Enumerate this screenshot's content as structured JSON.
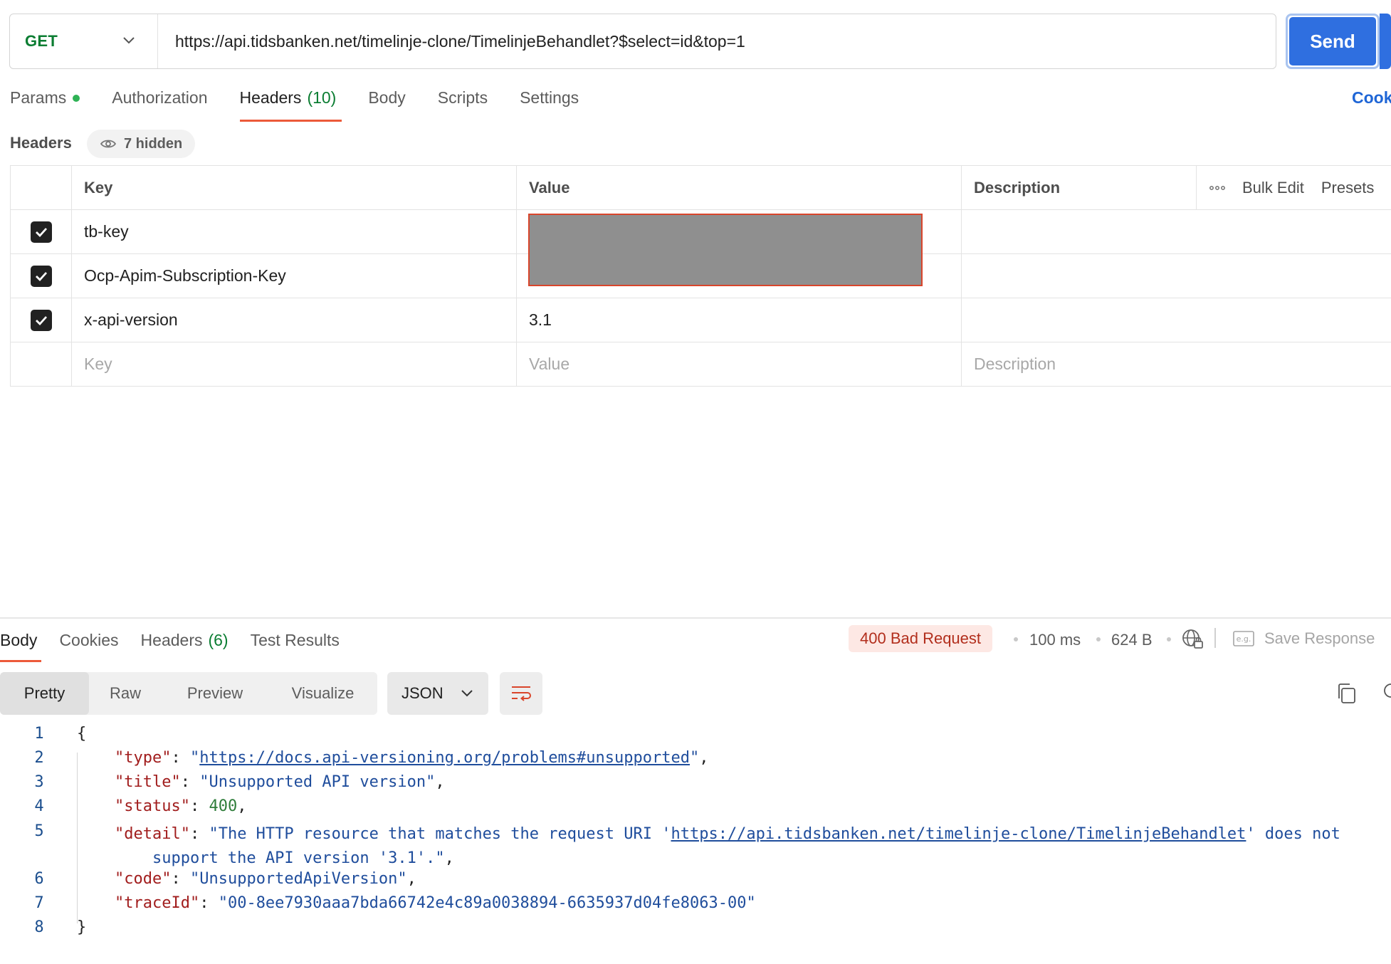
{
  "request": {
    "method": "GET",
    "url": "https://api.tidsbanken.net/timelinje-clone/TimelinjeBehandlet?$select=id&top=1",
    "send_label": "Send"
  },
  "request_tabs": {
    "params": "Params",
    "authorization": "Authorization",
    "headers": "Headers",
    "headers_count": "(10)",
    "body": "Body",
    "scripts": "Scripts",
    "settings": "Settings",
    "cookies_link": "Cook"
  },
  "headers_section": {
    "label": "Headers",
    "hidden_label": "7 hidden",
    "columns": {
      "key": "Key",
      "value": "Value",
      "description": "Description"
    },
    "bulk_edit": "Bulk Edit",
    "presets": "Presets",
    "rows": [
      {
        "key": "tb-key",
        "value": "",
        "enabled": true
      },
      {
        "key": "Ocp-Apim-Subscription-Key",
        "value": "",
        "enabled": true
      },
      {
        "key": "x-api-version",
        "value": "3.1",
        "enabled": true
      }
    ],
    "placeholders": {
      "key": "Key",
      "value": "Value",
      "description": "Description"
    }
  },
  "response": {
    "tabs": {
      "body": "Body",
      "cookies": "Cookies",
      "headers": "Headers",
      "headers_count": "(6)",
      "test_results": "Test Results"
    },
    "status": "400 Bad Request",
    "time": "100 ms",
    "size": "624 B",
    "save_label": "Save Response",
    "view_modes": [
      "Pretty",
      "Raw",
      "Preview",
      "Visualize"
    ],
    "format": "JSON",
    "json": {
      "type_url": "https://docs.api-versioning.org/problems#unsupported",
      "title": "Unsupported API version",
      "status": "400",
      "detail_prefix": "The HTTP resource that matches the request URI '",
      "detail_url": "https://api.tidsbanken.net/timelinje-clone/TimelinjeBehandlet",
      "detail_suffix": "' does not",
      "detail_cont": "support the API version '3.1'.",
      "code": "UnsupportedApiVersion",
      "traceId": "00-8ee7930aaa7bda66742e4c89a0038894-6635937d04fe8063-00"
    }
  },
  "colors": {
    "send": "#2f6fe0",
    "method_get": "#0b7d32",
    "status_error_bg": "#fde8e4",
    "status_error_text": "#b22e1c",
    "tab_underline": "#ec5a3a"
  },
  "icons": [
    "chevron-down-icon",
    "eye-icon",
    "more-icon",
    "check-icon",
    "globe-lock-icon",
    "example-icon",
    "wrap-lines-icon",
    "copy-icon"
  ]
}
